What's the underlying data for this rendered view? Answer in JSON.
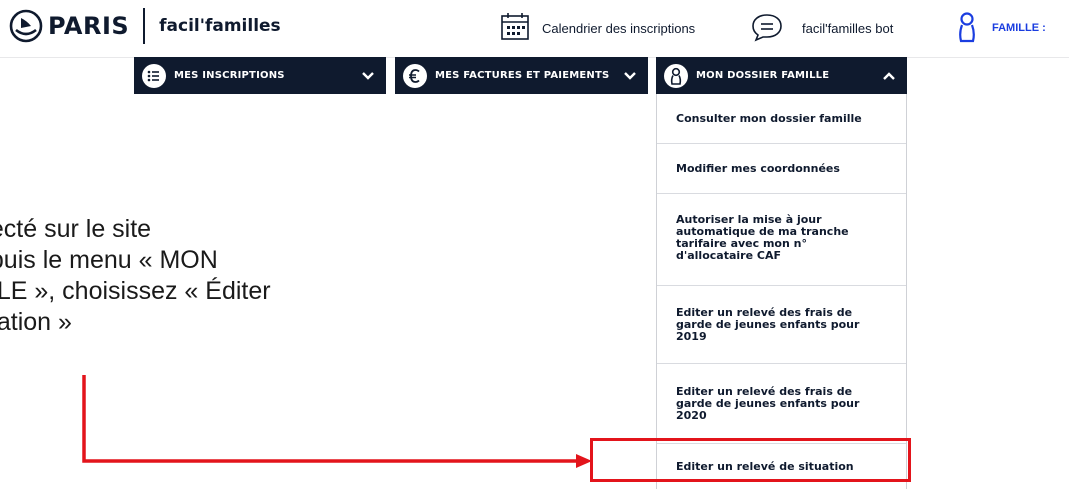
{
  "header": {
    "logo_text": "PARIS",
    "app_name": "facil'familles",
    "links": [
      {
        "label": "Calendrier des inscriptions",
        "icon": "calendar-icon"
      },
      {
        "label": "facil'familles bot",
        "icon": "chat-bubble-icon"
      },
      {
        "label": "FAMILLE :",
        "icon": "family-icon"
      }
    ]
  },
  "nav": {
    "items": [
      {
        "label": "MES INSCRIPTIONS",
        "icon": "list-icon"
      },
      {
        "label": "MES FACTURES ET PAIEMENTS",
        "icon": "euro-icon"
      },
      {
        "label": "MON DOSSIER FAMILLE",
        "icon": "family-icon"
      }
    ]
  },
  "dropdown": {
    "items": [
      {
        "label": "Consulter mon dossier famille"
      },
      {
        "label": "Modifier mes coordonnées"
      },
      {
        "label": "Autoriser la mise à jour automatique de ma tranche tarifaire avec mon n° d'allocataire CAF"
      },
      {
        "label": "Editer un relevé des frais de garde de jeunes enfants pour 2019"
      },
      {
        "label": "Editer un relevé des frais de garde de jeunes enfants pour 2020"
      },
      {
        "label": "Editer un relevé de situation"
      }
    ]
  },
  "annotation": {
    "lines": [
      "necté sur le site",
      "epuis le menu « MON",
      "ILLE », choisissez « Éditer",
      "tuation »"
    ],
    "highlight_color": "#e3141b"
  },
  "colors": {
    "navy": "#0f1a2e",
    "accent": "#e3141b"
  }
}
